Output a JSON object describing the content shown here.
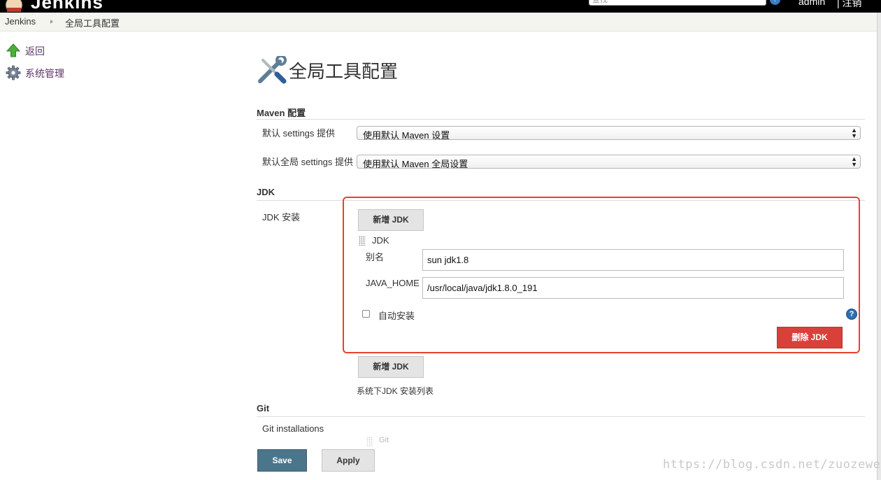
{
  "header": {
    "brand": "Jenkins",
    "search_placeholder": "查找",
    "user": "admin",
    "logout": "| 注销"
  },
  "breadcrumbs": [
    "Jenkins",
    "全局工具配置"
  ],
  "sidebar": {
    "items": [
      {
        "label": "返回",
        "icon": "up-arrow-icon"
      },
      {
        "label": "系统管理",
        "icon": "gear-icon"
      }
    ]
  },
  "page": {
    "title": "全局工具配置",
    "title_icon": "wrench-screwdriver-icon"
  },
  "maven": {
    "heading": "Maven 配置",
    "settings_label": "默认 settings 提供",
    "settings_value": "使用默认 Maven 设置",
    "global_settings_label": "默认全局 settings 提供",
    "global_settings_value": "使用默认 Maven 全局设置"
  },
  "jdk": {
    "heading": "JDK",
    "install_label": "JDK 安装",
    "add_button": "新增 JDK",
    "entry_title": "JDK",
    "alias_label": "别名",
    "alias_value": "sun jdk1.8",
    "java_home_label": "JAVA_HOME",
    "java_home_value": "/usr/local/java/jdk1.8.0_191",
    "auto_install_label": "自动安装",
    "auto_install_checked": false,
    "delete_button": "删除 JDK",
    "add_button_2": "新增 JDK",
    "description": "系统下JDK 安装列表",
    "highlight_color": "#e8422f"
  },
  "git": {
    "heading": "Git",
    "installations_label": "Git installations",
    "entry_title_faded": "Git"
  },
  "actions": {
    "save": "Save",
    "apply": "Apply"
  },
  "watermark": "https://blog.csdn.net/zuozewei"
}
